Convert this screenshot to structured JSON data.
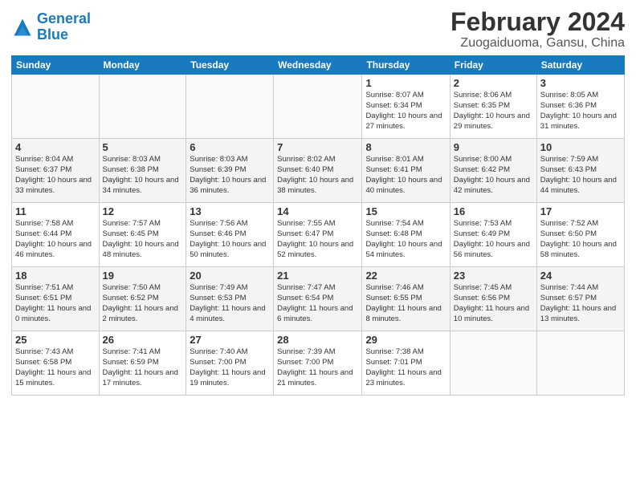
{
  "header": {
    "logo_line1": "General",
    "logo_line2": "Blue",
    "title": "February 2024",
    "subtitle": "Zuogaiduoma, Gansu, China"
  },
  "days_of_week": [
    "Sunday",
    "Monday",
    "Tuesday",
    "Wednesday",
    "Thursday",
    "Friday",
    "Saturday"
  ],
  "weeks": [
    [
      {
        "day": "",
        "info": ""
      },
      {
        "day": "",
        "info": ""
      },
      {
        "day": "",
        "info": ""
      },
      {
        "day": "",
        "info": ""
      },
      {
        "day": "1",
        "info": "Sunrise: 8:07 AM\nSunset: 6:34 PM\nDaylight: 10 hours and 27 minutes."
      },
      {
        "day": "2",
        "info": "Sunrise: 8:06 AM\nSunset: 6:35 PM\nDaylight: 10 hours and 29 minutes."
      },
      {
        "day": "3",
        "info": "Sunrise: 8:05 AM\nSunset: 6:36 PM\nDaylight: 10 hours and 31 minutes."
      }
    ],
    [
      {
        "day": "4",
        "info": "Sunrise: 8:04 AM\nSunset: 6:37 PM\nDaylight: 10 hours and 33 minutes."
      },
      {
        "day": "5",
        "info": "Sunrise: 8:03 AM\nSunset: 6:38 PM\nDaylight: 10 hours and 34 minutes."
      },
      {
        "day": "6",
        "info": "Sunrise: 8:03 AM\nSunset: 6:39 PM\nDaylight: 10 hours and 36 minutes."
      },
      {
        "day": "7",
        "info": "Sunrise: 8:02 AM\nSunset: 6:40 PM\nDaylight: 10 hours and 38 minutes."
      },
      {
        "day": "8",
        "info": "Sunrise: 8:01 AM\nSunset: 6:41 PM\nDaylight: 10 hours and 40 minutes."
      },
      {
        "day": "9",
        "info": "Sunrise: 8:00 AM\nSunset: 6:42 PM\nDaylight: 10 hours and 42 minutes."
      },
      {
        "day": "10",
        "info": "Sunrise: 7:59 AM\nSunset: 6:43 PM\nDaylight: 10 hours and 44 minutes."
      }
    ],
    [
      {
        "day": "11",
        "info": "Sunrise: 7:58 AM\nSunset: 6:44 PM\nDaylight: 10 hours and 46 minutes."
      },
      {
        "day": "12",
        "info": "Sunrise: 7:57 AM\nSunset: 6:45 PM\nDaylight: 10 hours and 48 minutes."
      },
      {
        "day": "13",
        "info": "Sunrise: 7:56 AM\nSunset: 6:46 PM\nDaylight: 10 hours and 50 minutes."
      },
      {
        "day": "14",
        "info": "Sunrise: 7:55 AM\nSunset: 6:47 PM\nDaylight: 10 hours and 52 minutes."
      },
      {
        "day": "15",
        "info": "Sunrise: 7:54 AM\nSunset: 6:48 PM\nDaylight: 10 hours and 54 minutes."
      },
      {
        "day": "16",
        "info": "Sunrise: 7:53 AM\nSunset: 6:49 PM\nDaylight: 10 hours and 56 minutes."
      },
      {
        "day": "17",
        "info": "Sunrise: 7:52 AM\nSunset: 6:50 PM\nDaylight: 10 hours and 58 minutes."
      }
    ],
    [
      {
        "day": "18",
        "info": "Sunrise: 7:51 AM\nSunset: 6:51 PM\nDaylight: 11 hours and 0 minutes."
      },
      {
        "day": "19",
        "info": "Sunrise: 7:50 AM\nSunset: 6:52 PM\nDaylight: 11 hours and 2 minutes."
      },
      {
        "day": "20",
        "info": "Sunrise: 7:49 AM\nSunset: 6:53 PM\nDaylight: 11 hours and 4 minutes."
      },
      {
        "day": "21",
        "info": "Sunrise: 7:47 AM\nSunset: 6:54 PM\nDaylight: 11 hours and 6 minutes."
      },
      {
        "day": "22",
        "info": "Sunrise: 7:46 AM\nSunset: 6:55 PM\nDaylight: 11 hours and 8 minutes."
      },
      {
        "day": "23",
        "info": "Sunrise: 7:45 AM\nSunset: 6:56 PM\nDaylight: 11 hours and 10 minutes."
      },
      {
        "day": "24",
        "info": "Sunrise: 7:44 AM\nSunset: 6:57 PM\nDaylight: 11 hours and 13 minutes."
      }
    ],
    [
      {
        "day": "25",
        "info": "Sunrise: 7:43 AM\nSunset: 6:58 PM\nDaylight: 11 hours and 15 minutes."
      },
      {
        "day": "26",
        "info": "Sunrise: 7:41 AM\nSunset: 6:59 PM\nDaylight: 11 hours and 17 minutes."
      },
      {
        "day": "27",
        "info": "Sunrise: 7:40 AM\nSunset: 7:00 PM\nDaylight: 11 hours and 19 minutes."
      },
      {
        "day": "28",
        "info": "Sunrise: 7:39 AM\nSunset: 7:00 PM\nDaylight: 11 hours and 21 minutes."
      },
      {
        "day": "29",
        "info": "Sunrise: 7:38 AM\nSunset: 7:01 PM\nDaylight: 11 hours and 23 minutes."
      },
      {
        "day": "",
        "info": ""
      },
      {
        "day": "",
        "info": ""
      }
    ]
  ]
}
